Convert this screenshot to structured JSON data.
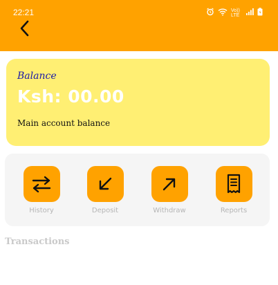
{
  "status_bar": {
    "time": "22:21",
    "icons": [
      "alarm-icon",
      "wifi-icon",
      "volte-icon",
      "signal-icon",
      "battery-icon"
    ],
    "volte_text": "Vo)) LTE"
  },
  "header": {
    "back_icon": "chevron-left-icon",
    "color": "#FFA200"
  },
  "balance_card": {
    "label": "Balance",
    "amount": "Ksh: 00.00",
    "caption": "Main account balance",
    "color": "#FFEF73"
  },
  "actions": [
    {
      "label": "History",
      "icon": "swap-arrows-icon"
    },
    {
      "label": "Deposit",
      "icon": "arrow-down-left-icon"
    },
    {
      "label": "Withdraw",
      "icon": "arrow-up-right-icon"
    },
    {
      "label": "Reports",
      "icon": "receipt-icon"
    }
  ],
  "transactions": {
    "title": "Transactions"
  }
}
